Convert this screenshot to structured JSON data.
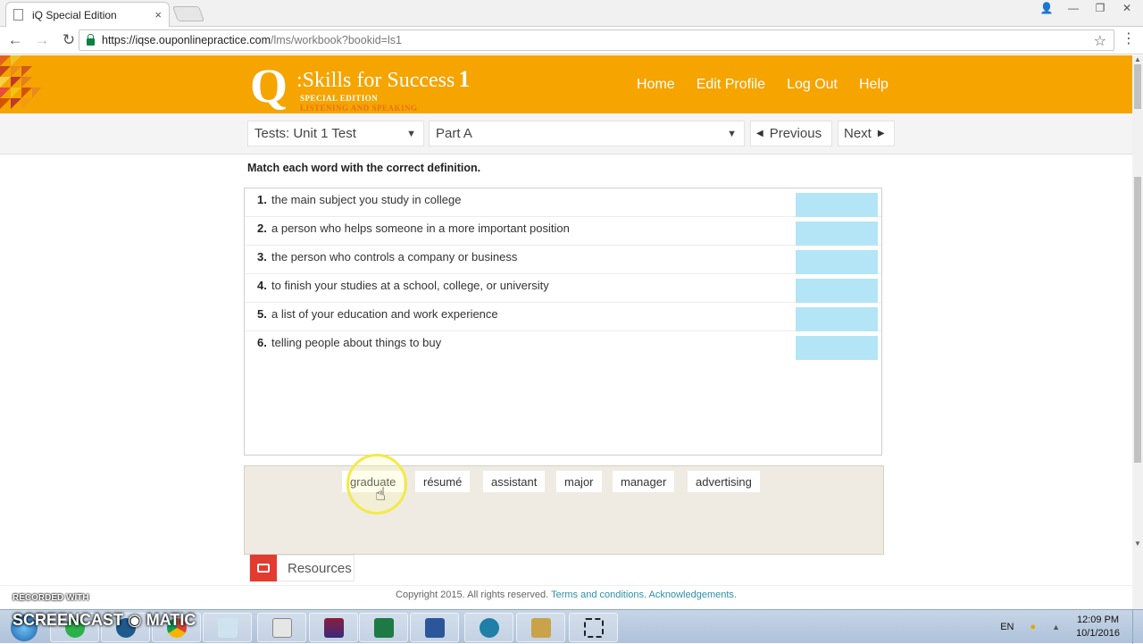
{
  "browser": {
    "tab_title": "iQ Special Edition",
    "tab_close": "×",
    "url_host": "https://iqse.ouponlinepractice.com",
    "url_path": "/lms/workbook?bookid=ls1",
    "window_controls": [
      "👤",
      "—",
      "❐",
      "✕"
    ]
  },
  "header": {
    "logo_q": "Q",
    "logo_title": ":Skills for Success",
    "logo_level": "1",
    "logo_special": "SPECIAL EDITION",
    "logo_skill": "LISTENING AND SPEAKING",
    "nav": [
      "Home",
      "Edit Profile",
      "Log Out",
      "Help"
    ],
    "colors": {
      "brand": "#f5a400",
      "sub": "#e9731d"
    }
  },
  "selector": {
    "test": "Tests: Unit 1 Test",
    "part": "Part A",
    "previous": "Previous",
    "next": "Next"
  },
  "exercise": {
    "instructions": "Match each word with the correct definition.",
    "items": [
      {
        "num": "1.",
        "text": "the main subject you study in college"
      },
      {
        "num": "2.",
        "text": "a person who helps someone in a more important position"
      },
      {
        "num": "3.",
        "text": "the person who controls a company or business"
      },
      {
        "num": "4.",
        "text": "to finish your studies at a school, college, or university"
      },
      {
        "num": "5.",
        "text": "a list of your education and work experience"
      },
      {
        "num": "6.",
        "text": "telling people about things to buy"
      }
    ],
    "words": [
      "graduate",
      "résumé",
      "assistant",
      "major",
      "manager",
      "advertising"
    ],
    "drop_color": "#b3e5f7"
  },
  "resources": {
    "label": "Resources"
  },
  "footer": {
    "copyright": "Copyright 2015. All rights reserved.",
    "terms": "Terms and conditions.",
    "ack": "Acknowledgements."
  },
  "watermark": {
    "recorded": "RECORDED WITH",
    "brand": "SCREENCAST ◉ MATIC"
  },
  "taskbar": {
    "lang": "EN",
    "time": "12:09 PM",
    "date": "10/1/2016",
    "apps": [
      "start-orb",
      "skype",
      "screencast",
      "chrome",
      "notepad",
      "calculator",
      "winrar",
      "excel",
      "word",
      "app-q",
      "keys",
      "snipping"
    ]
  }
}
